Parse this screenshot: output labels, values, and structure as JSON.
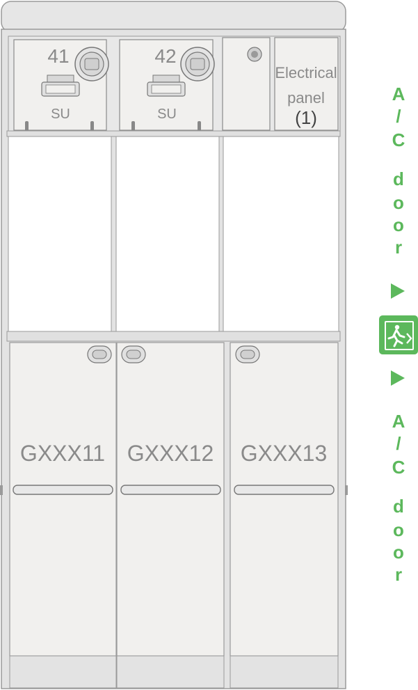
{
  "compartments": {
    "top_units": [
      {
        "number": "41",
        "label": "SU"
      },
      {
        "number": "42",
        "label": "SU"
      }
    ],
    "electrical_panel": {
      "line1": "Electrical",
      "line2": "panel",
      "line3": "(1)"
    }
  },
  "carts": [
    {
      "label": "GXXX11"
    },
    {
      "label": "GXXX12"
    },
    {
      "label": "GXXX13"
    }
  ],
  "side_signage": {
    "door_text_top": [
      "A",
      "/",
      "C",
      "d",
      "o",
      "o",
      "r"
    ],
    "door_text_bottom": [
      "A",
      "/",
      "C",
      "d",
      "o",
      "o",
      "r"
    ],
    "arrow_icon": "triangle-right-icon",
    "exit_icon": "emergency-exit-icon",
    "color": "#5cb85c"
  },
  "colors": {
    "frame": "#e3e3e3",
    "panel": "#f1f0ee",
    "outline": "#9a9a9a",
    "label_text": "#8a8a8a",
    "accent_green": "#5cb85c"
  }
}
